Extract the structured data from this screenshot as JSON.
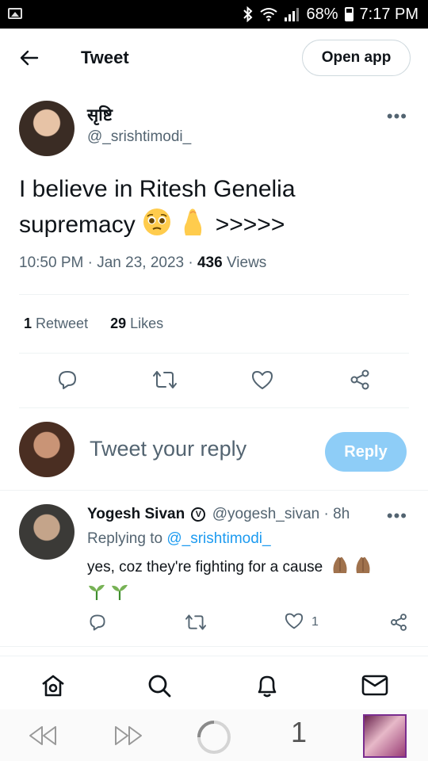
{
  "status_bar": {
    "battery": "68%",
    "time": "7:17 PM",
    "icons": [
      "image-icon",
      "bluetooth-icon",
      "wifi-icon",
      "signal-icon",
      "battery-icon"
    ]
  },
  "header": {
    "back_icon": "arrow-left-icon",
    "title": "Tweet",
    "open_app_label": "Open app"
  },
  "tweet": {
    "author": {
      "name": "सृष्टि",
      "handle": "@_srishtimodi_"
    },
    "text_line1": "I believe in Ritesh Genelia",
    "text_line2_word": "supremacy",
    "text_line2_tail": ">>>>>",
    "emojis": [
      "pleading-face-emoji",
      "pinched-fingers-emoji"
    ],
    "time": "10:50 PM",
    "date": "Jan 23, 2023",
    "views_count": "436",
    "views_label": "Views",
    "retweets_count": "1",
    "retweets_label": "Retweet",
    "likes_count": "29",
    "likes_label": "Likes"
  },
  "actions": [
    "reply-icon",
    "retweet-icon",
    "like-icon",
    "share-icon"
  ],
  "composer": {
    "placeholder": "Tweet your reply",
    "reply_button": "Reply"
  },
  "reply": {
    "name": "Yogesh Sivan",
    "handle": "@yogesh_sivan",
    "time": "8h",
    "replying_prefix": "Replying to",
    "replying_mention": "@_srishtimodi_",
    "text": "yes, coz they're fighting for a cause",
    "emojis": [
      "folded-hands-emoji",
      "folded-hands-emoji",
      "seedling-emoji",
      "seedling-emoji"
    ],
    "like_count": "1"
  },
  "bottom_nav": [
    "home-icon",
    "search-icon",
    "notifications-icon",
    "messages-icon"
  ],
  "browser_bar": {
    "tab_count": "1",
    "items": [
      "rewind-icon",
      "fast-forward-icon",
      "loading-icon",
      "tabs-counter",
      "page-thumbnail"
    ]
  },
  "colors": {
    "accent": "#1d9bf0",
    "reply_button_bg": "#8ecdf7",
    "secondary_text": "#536471",
    "primary_text": "#0f1419",
    "divider": "#eff3f4"
  }
}
